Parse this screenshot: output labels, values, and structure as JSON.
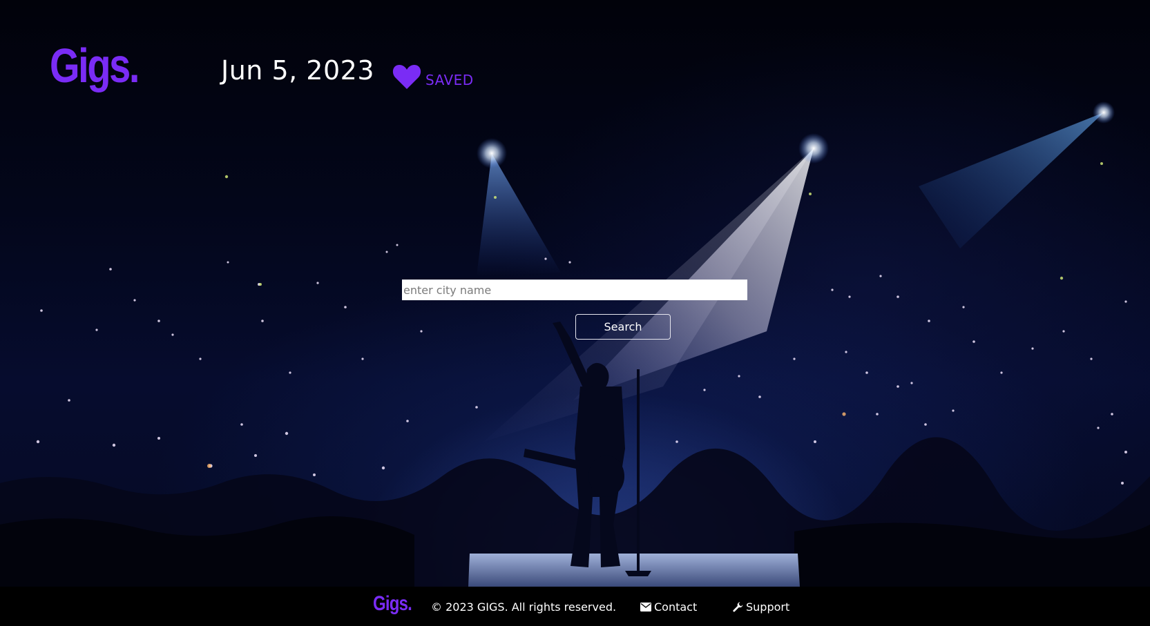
{
  "brand": {
    "logo_text": "Gigs.",
    "accent_color": "#7a2cf5"
  },
  "header": {
    "date": "Jun 5, 2023",
    "saved_label": "SAVED",
    "saved_icon": "heart-icon"
  },
  "search": {
    "placeholder": "enter city name",
    "value": "",
    "button_label": "Search"
  },
  "footer": {
    "logo_text": "Gigs.",
    "copyright": "© 2023 GIGS. All rights reserved.",
    "links": [
      {
        "label": "Contact",
        "icon": "envelope-icon"
      },
      {
        "label": "Support",
        "icon": "wrench-icon"
      }
    ]
  }
}
